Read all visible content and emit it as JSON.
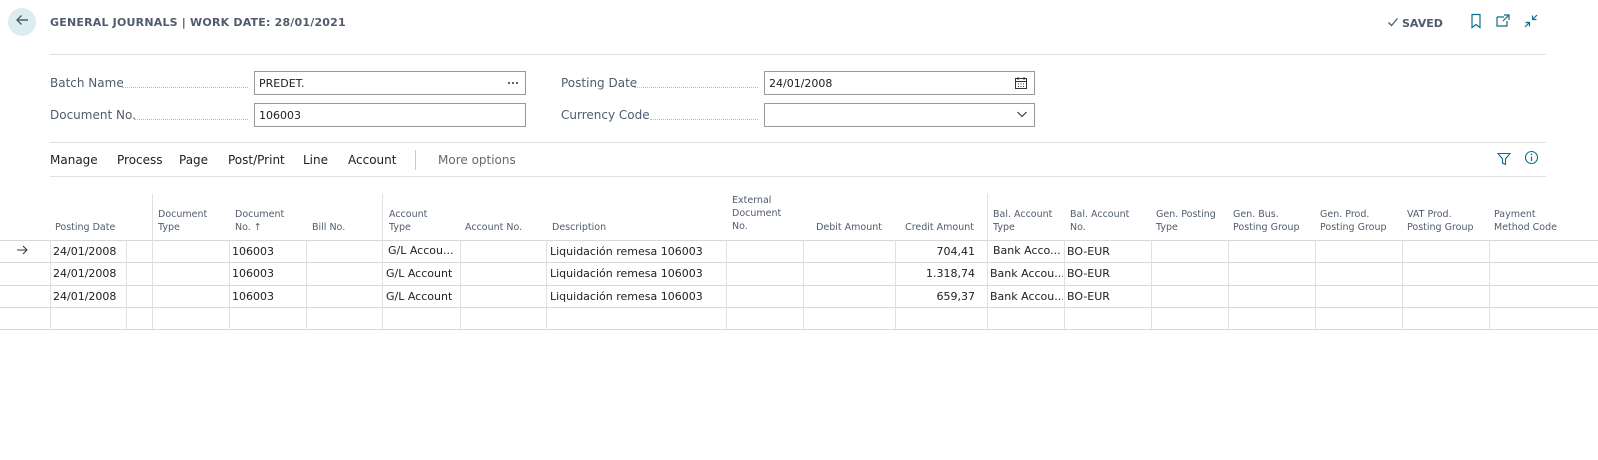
{
  "header": {
    "title": "GENERAL JOURNALS | WORK DATE: 28/01/2021",
    "saved_label": "SAVED",
    "icons": [
      "back-arrow-icon",
      "check-icon",
      "bookmark-icon",
      "open-new-window-icon",
      "collapse-icon"
    ]
  },
  "fields": {
    "batch_name": {
      "label": "Batch Name",
      "value": "PREDET."
    },
    "document_no": {
      "label": "Document No.",
      "value": "106003"
    },
    "posting_date": {
      "label": "Posting Date",
      "value": "24/01/2008"
    },
    "currency_code": {
      "label": "Currency Code",
      "value": ""
    }
  },
  "actions": {
    "manage": "Manage",
    "process": "Process",
    "page": "Page",
    "post_print": "Post/Print",
    "line": "Line",
    "account": "Account",
    "more_options": "More options"
  },
  "columns": {
    "posting_date": "Posting Date",
    "document_type": [
      "Document",
      "Type"
    ],
    "document_no": [
      "Document",
      "No. ↑"
    ],
    "bill_no": "Bill No.",
    "account_type": [
      "Account",
      "Type"
    ],
    "account_no": "Account No.",
    "description": "Description",
    "external_document_no": [
      "External",
      "Document",
      "No."
    ],
    "debit_amount": "Debit Amount",
    "credit_amount": "Credit Amount",
    "bal_account_type": [
      "Bal. Account",
      "Type"
    ],
    "bal_account_no": [
      "Bal. Account",
      "No."
    ],
    "gen_posting_type": [
      "Gen. Posting",
      "Type"
    ],
    "gen_bus_posting_group": [
      "Gen. Bus.",
      "Posting Group"
    ],
    "gen_prod_posting_group": [
      "Gen. Prod.",
      "Posting Group"
    ],
    "vat_prod_posting_group": [
      "VAT Prod.",
      "Posting Group"
    ],
    "payment_method_code": [
      "Payment",
      "Method Code"
    ]
  },
  "rows": [
    {
      "posting_date": "24/01/2008",
      "document_no": "106003",
      "account_type": "G/L Accou...",
      "description": "Liquidación remesa 106003",
      "credit_amount": "704,41",
      "bal_account_type": "Bank Acco...",
      "bal_account_no": "BO-EUR"
    },
    {
      "posting_date": "24/01/2008",
      "document_no": "106003",
      "account_type": "G/L Account",
      "description": "Liquidación remesa 106003",
      "credit_amount": "1.318,74",
      "bal_account_type": "Bank Accou...",
      "bal_account_no": "BO-EUR"
    },
    {
      "posting_date": "24/01/2008",
      "document_no": "106003",
      "account_type": "G/L Account",
      "description": "Liquidación remesa 106003",
      "credit_amount": "659,37",
      "bal_account_type": "Bank Accou...",
      "bal_account_no": "BO-EUR"
    }
  ]
}
